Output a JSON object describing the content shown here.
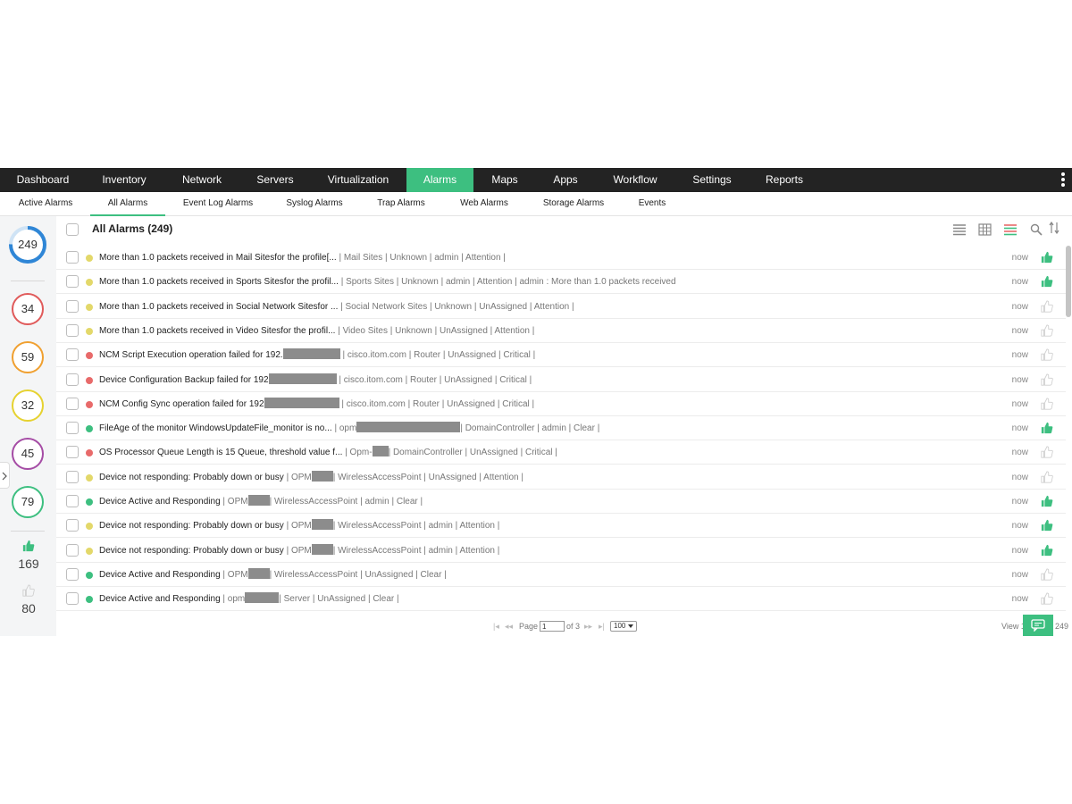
{
  "main_nav": {
    "items": [
      "Dashboard",
      "Inventory",
      "Network",
      "Servers",
      "Virtualization",
      "Alarms",
      "Maps",
      "Apps",
      "Workflow",
      "Settings",
      "Reports"
    ],
    "active": "Alarms"
  },
  "sub_nav": {
    "items": [
      "Active Alarms",
      "All Alarms",
      "Event Log Alarms",
      "Syslog Alarms",
      "Trap Alarms",
      "Web Alarms",
      "Storage Alarms",
      "Events"
    ],
    "active": "All Alarms"
  },
  "summary": {
    "total": "249",
    "severity_counts": [
      {
        "count": "34",
        "color": "#e05a5a"
      },
      {
        "count": "59",
        "color": "#f0a030"
      },
      {
        "count": "32",
        "color": "#e6d230"
      },
      {
        "count": "45",
        "color": "#a54ca5"
      },
      {
        "count": "79",
        "color": "#3dbf80"
      }
    ],
    "acknowledged": "169",
    "unacknowledged": "80"
  },
  "panel": {
    "title": "All Alarms (249)"
  },
  "colors": {
    "accent": "#3dbf80",
    "attention": "#e3d86a",
    "critical": "#e86a6a",
    "clear": "#3dbf80",
    "thumb_on": "#3dbf80",
    "thumb_off": "#cfcfcf"
  },
  "alarms": [
    {
      "message": "More than 1.0 packets received in Mail Sitesfor the profile[...",
      "meta": "| Mail Sites | Unknown | admin | Attention |",
      "severity": "attention",
      "time": "now",
      "acked": true
    },
    {
      "message": "More than 1.0 packets received in Sports Sitesfor the profil...",
      "meta": "| Sports Sites | Unknown | admin | Attention | admin : More than 1.0 packets received",
      "severity": "attention",
      "time": "now",
      "acked": true
    },
    {
      "message": "More than 1.0 packets received in Social Network Sitesfor ...",
      "meta": "| Social Network Sites | Unknown | UnAssigned | Attention |",
      "severity": "attention",
      "time": "now",
      "acked": false
    },
    {
      "message": "More than 1.0 packets received in Video Sitesfor the profil...",
      "meta": "| Video Sites | Unknown | UnAssigned | Attention |",
      "severity": "attention",
      "time": "now",
      "acked": false
    },
    {
      "message": "NCM Script Execution operation failed for 192.",
      "redact": 64,
      "meta": "| cisco.itom.com | Router | UnAssigned | Critical |",
      "severity": "critical",
      "time": "now",
      "acked": false
    },
    {
      "message": "Device Configuration Backup failed for 192",
      "redact": 76,
      "meta": "| cisco.itom.com | Router | UnAssigned | Critical |",
      "severity": "critical",
      "time": "now",
      "acked": false
    },
    {
      "message": "NCM Config Sync operation failed for 192",
      "redact": 84,
      "meta": "| cisco.itom.com | Router | UnAssigned | Critical |",
      "severity": "critical",
      "time": "now",
      "acked": false
    },
    {
      "message": "FileAge of the monitor WindowsUpdateFile_monitor is no...",
      "meta_prefix": "| opm",
      "redact": 116,
      "meta": "| DomainController | admin | Clear |",
      "severity": "clear",
      "time": "now",
      "acked": true
    },
    {
      "message": "OS Processor Queue Length is 15 Queue, threshold value f...",
      "meta_prefix": "| Opm-",
      "redact": 18,
      "meta": "| DomainController | UnAssigned | Critical |",
      "severity": "critical",
      "time": "now",
      "acked": false
    },
    {
      "message": "Device not responding: Probably down or busy",
      "meta_prefix": "| OPM",
      "redact": 24,
      "meta": "| WirelessAccessPoint | UnAssigned | Attention |",
      "severity": "attention",
      "time": "now",
      "acked": false
    },
    {
      "message": "Device Active and Responding",
      "meta_prefix": "| OPM",
      "redact": 24,
      "meta": "| WirelessAccessPoint | admin | Clear |",
      "severity": "clear",
      "time": "now",
      "acked": true
    },
    {
      "message": "Device not responding: Probably down or busy",
      "meta_prefix": "| OPM",
      "redact": 24,
      "meta": "| WirelessAccessPoint | admin | Attention |",
      "severity": "attention",
      "time": "now",
      "acked": true
    },
    {
      "message": "Device not responding: Probably down or busy",
      "meta_prefix": "| OPM",
      "redact": 24,
      "meta": "| WirelessAccessPoint | admin | Attention |",
      "severity": "attention",
      "time": "now",
      "acked": true
    },
    {
      "message": "Device Active and Responding",
      "meta_prefix": "| OPM",
      "redact": 24,
      "meta": "| WirelessAccessPoint | UnAssigned | Clear |",
      "severity": "clear",
      "time": "now",
      "acked": false
    },
    {
      "message": "Device Active and Responding",
      "meta_prefix": "| opm",
      "redact": 38,
      "meta": "| Server | UnAssigned | Clear |",
      "severity": "clear",
      "time": "now",
      "acked": false
    }
  ],
  "pager": {
    "page_label": "Page",
    "page_value": "1",
    "of_label": "of 3",
    "page_size": "100",
    "view_label": "View 1",
    "view_end": "249"
  }
}
